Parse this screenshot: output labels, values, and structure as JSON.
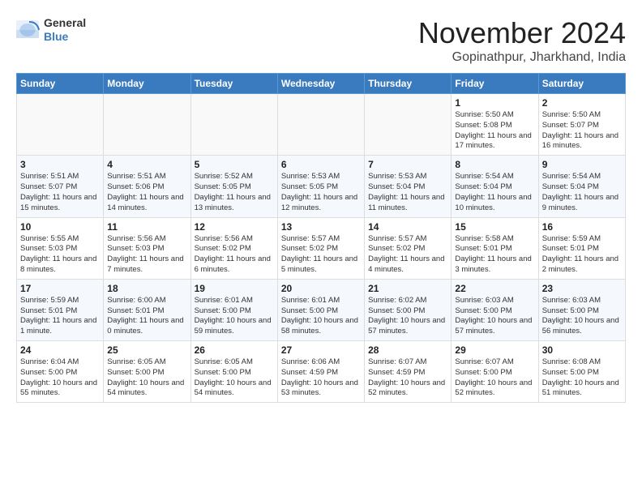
{
  "header": {
    "logo_line1": "General",
    "logo_line2": "Blue",
    "month_title": "November 2024",
    "location": "Gopinathpur, Jharkhand, India"
  },
  "days_of_week": [
    "Sunday",
    "Monday",
    "Tuesday",
    "Wednesday",
    "Thursday",
    "Friday",
    "Saturday"
  ],
  "weeks": [
    [
      {
        "day": "",
        "info": ""
      },
      {
        "day": "",
        "info": ""
      },
      {
        "day": "",
        "info": ""
      },
      {
        "day": "",
        "info": ""
      },
      {
        "day": "",
        "info": ""
      },
      {
        "day": "1",
        "info": "Sunrise: 5:50 AM\nSunset: 5:08 PM\nDaylight: 11 hours and 17 minutes."
      },
      {
        "day": "2",
        "info": "Sunrise: 5:50 AM\nSunset: 5:07 PM\nDaylight: 11 hours and 16 minutes."
      }
    ],
    [
      {
        "day": "3",
        "info": "Sunrise: 5:51 AM\nSunset: 5:07 PM\nDaylight: 11 hours and 15 minutes."
      },
      {
        "day": "4",
        "info": "Sunrise: 5:51 AM\nSunset: 5:06 PM\nDaylight: 11 hours and 14 minutes."
      },
      {
        "day": "5",
        "info": "Sunrise: 5:52 AM\nSunset: 5:05 PM\nDaylight: 11 hours and 13 minutes."
      },
      {
        "day": "6",
        "info": "Sunrise: 5:53 AM\nSunset: 5:05 PM\nDaylight: 11 hours and 12 minutes."
      },
      {
        "day": "7",
        "info": "Sunrise: 5:53 AM\nSunset: 5:04 PM\nDaylight: 11 hours and 11 minutes."
      },
      {
        "day": "8",
        "info": "Sunrise: 5:54 AM\nSunset: 5:04 PM\nDaylight: 11 hours and 10 minutes."
      },
      {
        "day": "9",
        "info": "Sunrise: 5:54 AM\nSunset: 5:04 PM\nDaylight: 11 hours and 9 minutes."
      }
    ],
    [
      {
        "day": "10",
        "info": "Sunrise: 5:55 AM\nSunset: 5:03 PM\nDaylight: 11 hours and 8 minutes."
      },
      {
        "day": "11",
        "info": "Sunrise: 5:56 AM\nSunset: 5:03 PM\nDaylight: 11 hours and 7 minutes."
      },
      {
        "day": "12",
        "info": "Sunrise: 5:56 AM\nSunset: 5:02 PM\nDaylight: 11 hours and 6 minutes."
      },
      {
        "day": "13",
        "info": "Sunrise: 5:57 AM\nSunset: 5:02 PM\nDaylight: 11 hours and 5 minutes."
      },
      {
        "day": "14",
        "info": "Sunrise: 5:57 AM\nSunset: 5:02 PM\nDaylight: 11 hours and 4 minutes."
      },
      {
        "day": "15",
        "info": "Sunrise: 5:58 AM\nSunset: 5:01 PM\nDaylight: 11 hours and 3 minutes."
      },
      {
        "day": "16",
        "info": "Sunrise: 5:59 AM\nSunset: 5:01 PM\nDaylight: 11 hours and 2 minutes."
      }
    ],
    [
      {
        "day": "17",
        "info": "Sunrise: 5:59 AM\nSunset: 5:01 PM\nDaylight: 11 hours and 1 minute."
      },
      {
        "day": "18",
        "info": "Sunrise: 6:00 AM\nSunset: 5:01 PM\nDaylight: 11 hours and 0 minutes."
      },
      {
        "day": "19",
        "info": "Sunrise: 6:01 AM\nSunset: 5:00 PM\nDaylight: 10 hours and 59 minutes."
      },
      {
        "day": "20",
        "info": "Sunrise: 6:01 AM\nSunset: 5:00 PM\nDaylight: 10 hours and 58 minutes."
      },
      {
        "day": "21",
        "info": "Sunrise: 6:02 AM\nSunset: 5:00 PM\nDaylight: 10 hours and 57 minutes."
      },
      {
        "day": "22",
        "info": "Sunrise: 6:03 AM\nSunset: 5:00 PM\nDaylight: 10 hours and 57 minutes."
      },
      {
        "day": "23",
        "info": "Sunrise: 6:03 AM\nSunset: 5:00 PM\nDaylight: 10 hours and 56 minutes."
      }
    ],
    [
      {
        "day": "24",
        "info": "Sunrise: 6:04 AM\nSunset: 5:00 PM\nDaylight: 10 hours and 55 minutes."
      },
      {
        "day": "25",
        "info": "Sunrise: 6:05 AM\nSunset: 5:00 PM\nDaylight: 10 hours and 54 minutes."
      },
      {
        "day": "26",
        "info": "Sunrise: 6:05 AM\nSunset: 5:00 PM\nDaylight: 10 hours and 54 minutes."
      },
      {
        "day": "27",
        "info": "Sunrise: 6:06 AM\nSunset: 4:59 PM\nDaylight: 10 hours and 53 minutes."
      },
      {
        "day": "28",
        "info": "Sunrise: 6:07 AM\nSunset: 4:59 PM\nDaylight: 10 hours and 52 minutes."
      },
      {
        "day": "29",
        "info": "Sunrise: 6:07 AM\nSunset: 5:00 PM\nDaylight: 10 hours and 52 minutes."
      },
      {
        "day": "30",
        "info": "Sunrise: 6:08 AM\nSunset: 5:00 PM\nDaylight: 10 hours and 51 minutes."
      }
    ]
  ]
}
